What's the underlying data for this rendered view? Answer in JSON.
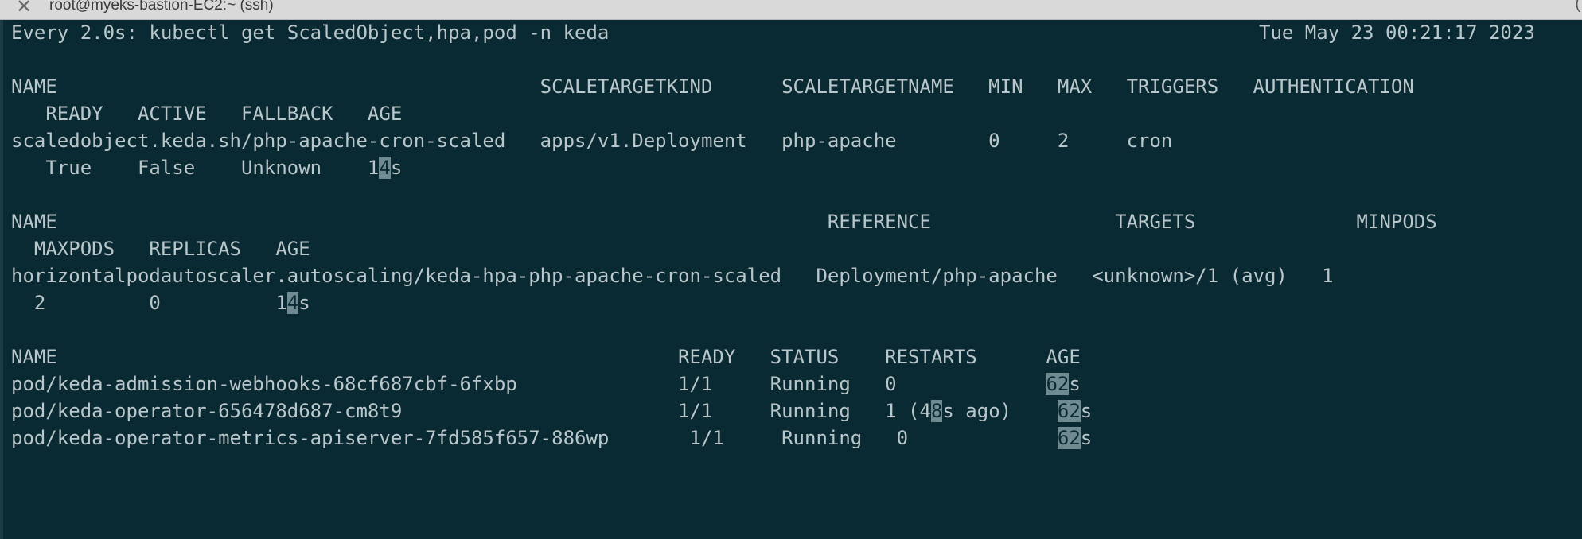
{
  "window": {
    "title": "root@myeks-bastion-EC2:~ (ssh)",
    "close_glyph": "✕",
    "right_glyph": "("
  },
  "terminal": {
    "watch_header": "Every 2.0s: kubectl get ScaledObject,hpa,pod -n keda",
    "timestamp": "Tue May 23 00:21:17 2023",
    "scaledobject": {
      "header_1": "NAME                                          SCALETARGETKIND      SCALETARGETNAME   MIN   MAX   TRIGGERS   AUTHENTICATION",
      "header_2": "   READY   ACTIVE   FALLBACK   AGE",
      "row_1": "scaledobject.keda.sh/php-apache-cron-scaled   apps/v1.Deployment   php-apache        0     2     cron",
      "row_2a": "   True    False    Unknown    1",
      "row_2_hl": "4",
      "row_2b": "s"
    },
    "hpa": {
      "header_1": "NAME                                                                   REFERENCE                TARGETS              MINPODS",
      "header_2": "  MAXPODS   REPLICAS   AGE",
      "row_1": "horizontalpodautoscaler.autoscaling/keda-hpa-php-apache-cron-scaled   Deployment/php-apache   <unknown>/1 (avg)   1",
      "row_2a": "  2         0          1",
      "row_2_hl": "4",
      "row_2b": "s"
    },
    "pods": {
      "header": "NAME                                                      READY   STATUS    RESTARTS      AGE",
      "rows": [
        {
          "a": "pod/keda-admission-webhooks-68cf687cbf-6fxbp              1/1     Running   0             ",
          "hl1": "",
          "b": "",
          "hl2": "62",
          "c": "s"
        },
        {
          "a": "pod/keda-operator-656478d687-cm8t9                        1/1     Running   1 (4",
          "hl1": "8",
          "b": "s ago)    ",
          "hl2": "62",
          "c": "s"
        },
        {
          "a": "pod/keda-operator-metrics-apiserver-7fd585f657-886wp       1/1     Running   0             ",
          "hl1": "",
          "b": "",
          "hl2": "62",
          "c": "s"
        }
      ]
    }
  }
}
